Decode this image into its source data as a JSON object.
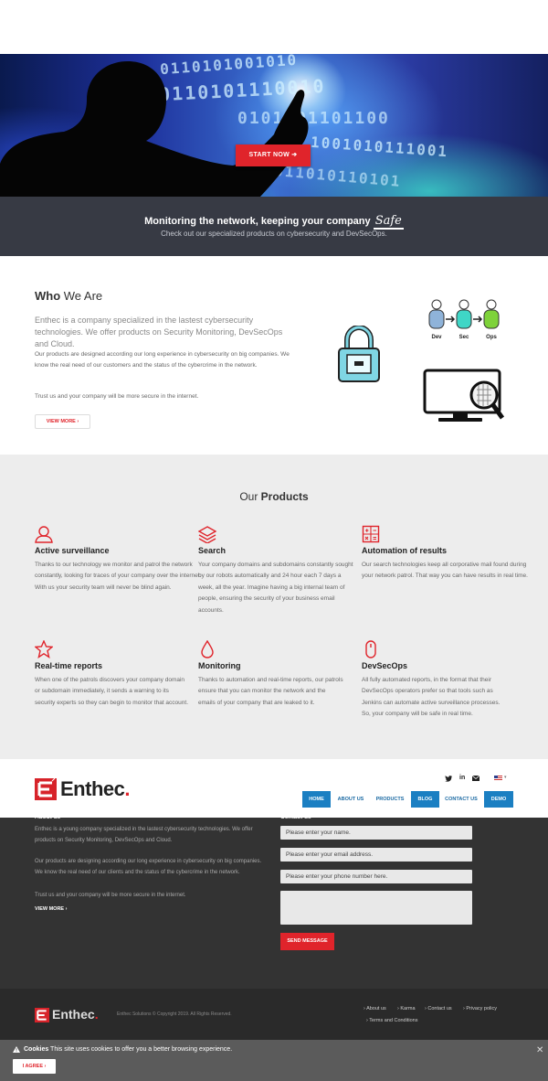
{
  "hero": {
    "cta_label": "START NOW ➔",
    "binary_rows": [
      "0110101001010",
      "10110101110010",
      "0101101101100",
      "1001010111001",
      "011010110101"
    ]
  },
  "tagline": {
    "headline": "Monitoring the network, keeping your company",
    "headline_accent": "Safe",
    "subline": "Check out our specialized products on cybersecurity and DevSecOps."
  },
  "who": {
    "title_bold": "Who",
    "title_rest": " We Are",
    "lead": "Enthec is a company specialized in the lastest cybersecurity technologies. We offer products on Security Monitoring, DevSecOps and Cloud.",
    "para1": "Our products are designed according our long experience in cybersecurity on big companies. We know the real need of our customers and the status of the cybercrime in the network.",
    "para2": "Trust us and your company will be more secure in the internet.",
    "more_label": "VIEW MORE  ›",
    "devsecops_labels": [
      "Dev",
      "Sec",
      "Ops"
    ]
  },
  "products": {
    "title_light": "Our ",
    "title_bold": "Products",
    "items": [
      {
        "name": "Active surveillance",
        "icon": "user-icon",
        "desc": "Thanks to our technology we monitor and patrol the network constantly, looking for traces of your company over the internet. With us your security team will never be blind again."
      },
      {
        "name": "Search",
        "icon": "layers-icon",
        "desc": "Your company domains and subdomains constantly sought by our robots automatically and 24 hour each 7 days a week, all the year. Imagine having a big internal team of people, ensuring the security of your business email accounts."
      },
      {
        "name": "Automation of results",
        "icon": "calculator-icon",
        "desc": "Our search technologies keep all corporative mail found during your network patrol. That way you can have results in real time."
      },
      {
        "name": "Real-time reports",
        "icon": "star-icon",
        "desc": "When one of the patrols discovers your company domain or subdomain immediately, it sends a warning to its security experts so they can begin to monitor that account."
      },
      {
        "name": "Monitoring",
        "icon": "drop-icon",
        "desc": "Thanks to automation and real-time reports, our patrols ensure that you can monitor the network and the emails of your company that are leaked to it."
      },
      {
        "name": "DevSecOps",
        "icon": "mouse-icon",
        "desc": "All fully automated reports, in the format that their DevSecOps operators prefer so that tools such as Jenkins can automate active surveillance processes. So, your company will be safe in real time."
      }
    ]
  },
  "header": {
    "logo_text": "Enthec",
    "logo_dot": ".",
    "nav": [
      "HOME",
      "ABOUT US",
      "PRODUCTS",
      "BLOG",
      "CONTACT US",
      "DEMO"
    ],
    "lang_label": "▾"
  },
  "footer": {
    "about_title": "About us",
    "about_p1": "Enthec is a young company specialized in the lastest cybersecurity technologies. We offer products on Security Monitoring, DevSecOps and Cloud.",
    "about_p2": "Our products are designing according our long experience in cybersecurity on big companies. We know the real need of our clients and the status of the cybercrime in the network.",
    "about_p3": "Trust us and your company will be more secure in the internet.",
    "about_more": "VIEW MORE  ›",
    "contact_title": "Contact us",
    "name_placeholder": "Please enter your name.",
    "email_placeholder": "Please enter your email address.",
    "phone_placeholder": "Please enter your phone number here.",
    "send_label": "SEND MESSAGE",
    "logo_text": "Enthec",
    "logo_dot": ".",
    "copyright": "Enthec Solutions © Copyright 2019. All Rights Reserved.",
    "links": [
      "About us",
      "Karma",
      "Contact us",
      "Privacy policy",
      "Terms and Conditions"
    ]
  },
  "cookie": {
    "bold": "Cookies",
    "text": " This site uses cookies to offer you a better browsing experience.",
    "agree_label": "I AGREE  ›",
    "close_label": "✕"
  },
  "colors": {
    "accent": "#e0242b",
    "nav_blue": "#1b7fc2",
    "dark": "#333333",
    "band": "#373a44"
  }
}
